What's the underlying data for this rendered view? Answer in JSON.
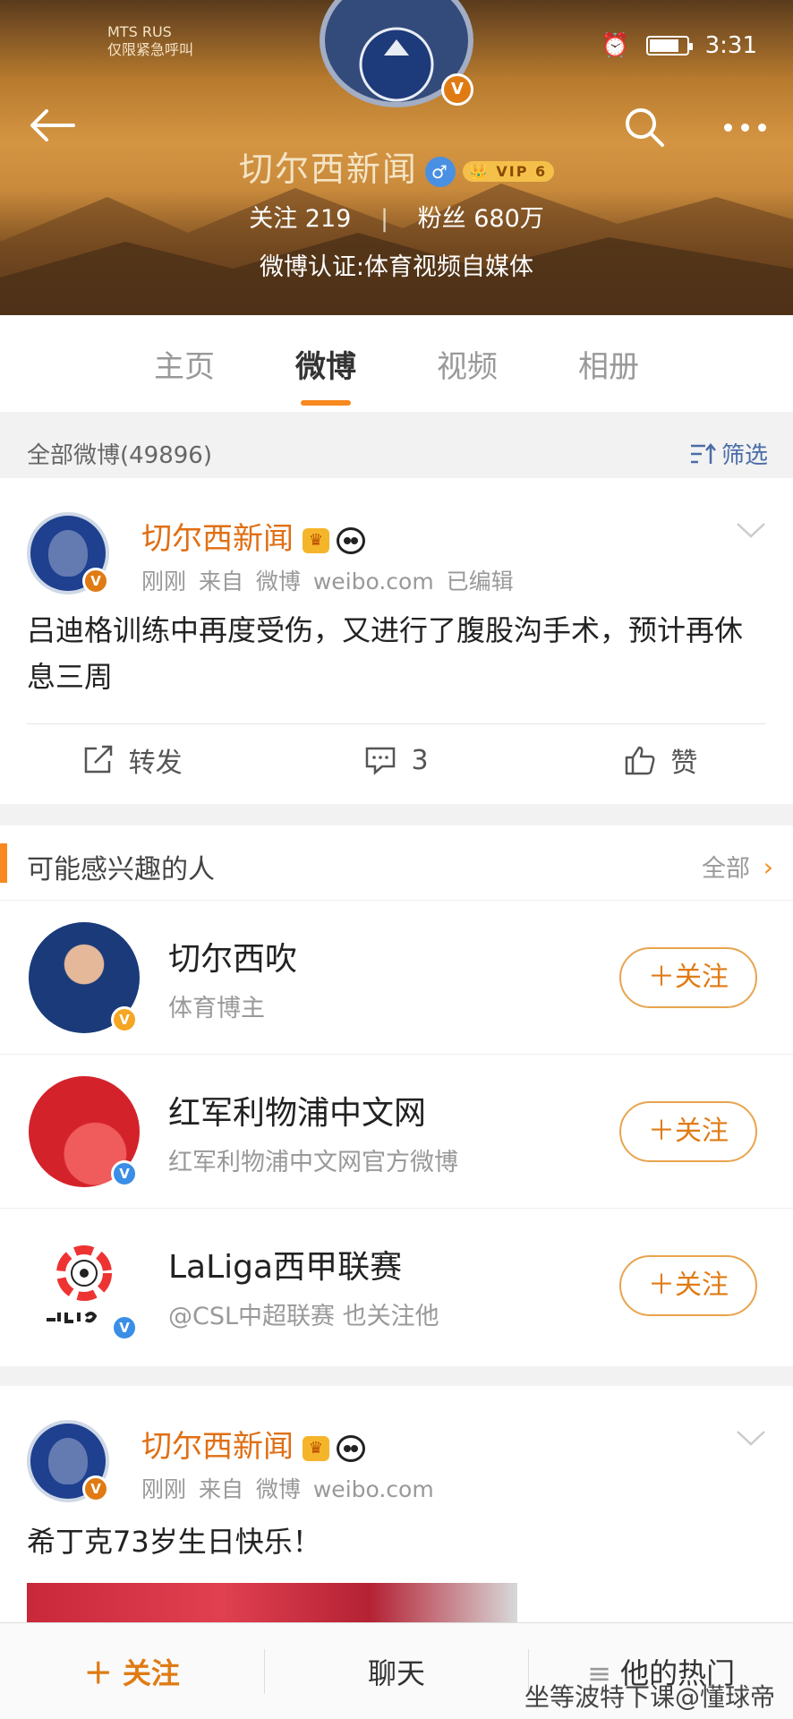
{
  "status_bar": {
    "carrier": "MTS RUS",
    "emergency": "仅限紧急呼叫",
    "time": "3:31",
    "battery_level": 0.8
  },
  "profile": {
    "name": "切尔西新闻",
    "vip": "VIP 6",
    "following_label": "关注",
    "following_count": "219",
    "followers_label": "粉丝",
    "followers_count": "680万",
    "certification": "微博认证:体育视频自媒体",
    "verified_badge": "V",
    "accent_color": "#e07b14"
  },
  "tabs": [
    {
      "label": "主页"
    },
    {
      "label": "微博",
      "active": true
    },
    {
      "label": "视频"
    },
    {
      "label": "相册"
    }
  ],
  "filter": {
    "count_label": "全部微博(49896)",
    "filter_label": "筛选"
  },
  "posts": [
    {
      "author": "切尔西新闻",
      "time": "刚刚",
      "source": "来自 微博 weibo.com",
      "edited": "已编辑",
      "text": "吕迪格训练中再度受伤，又进行了腹股沟手术，预计再休息三周",
      "repost_label": "转发",
      "comment_count": "3",
      "like_label": "赞"
    },
    {
      "author": "切尔西新闻",
      "time": "刚刚",
      "source": "来自 微博 weibo.com",
      "text": "希丁克73岁生日快乐！"
    }
  ],
  "recommend": {
    "title": "可能感兴趣的人",
    "all_label": "全部",
    "follow_label": "关注",
    "items": [
      {
        "name": "切尔西吹",
        "desc": "体育博主"
      },
      {
        "name": "红军利物浦中文网",
        "desc": "红军利物浦中文网官方微博"
      },
      {
        "name": "LaLiga西甲联赛",
        "desc": "@CSL中超联赛 也关注他"
      }
    ]
  },
  "bottom_bar": {
    "follow_label": "关注",
    "chat_label": "聊天",
    "hot_label": "他的热门"
  },
  "watermark": "坐等波特下课@懂球帝"
}
